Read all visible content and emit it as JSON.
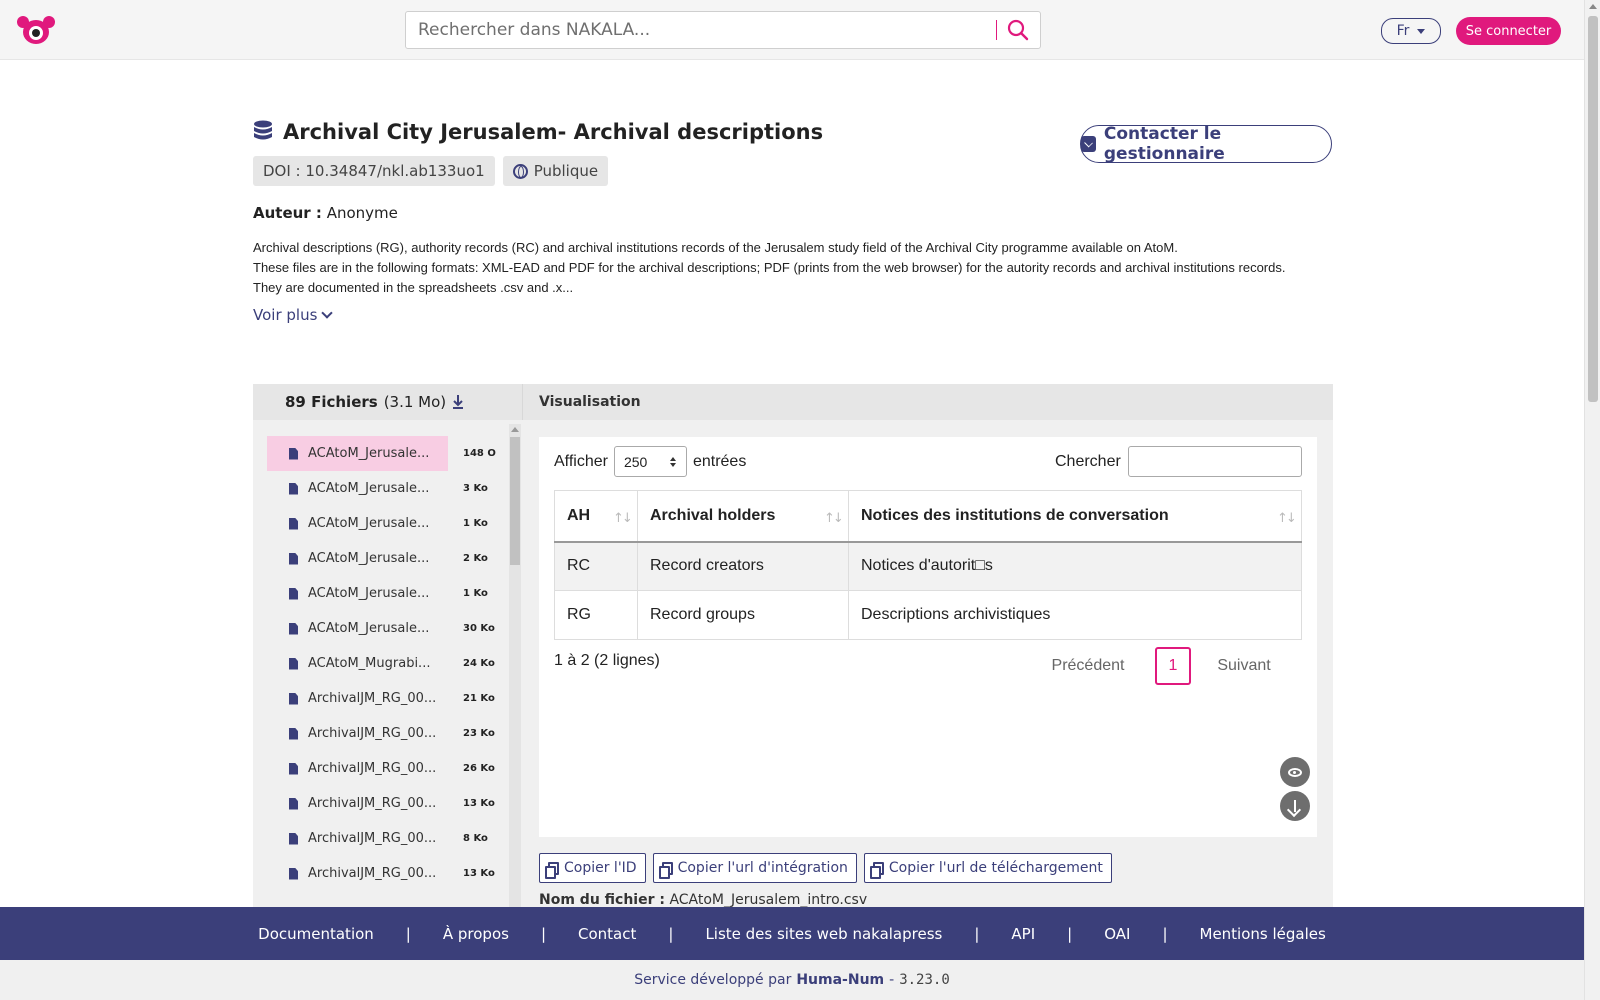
{
  "navbar": {
    "search_placeholder": "Rechercher dans NAKALA...",
    "lang": "Fr",
    "login": "Se connecter"
  },
  "header": {
    "title": "Archival City Jerusalem- Archival descriptions",
    "contact_button": "Contacter le gestionnaire",
    "doi": "DOI : 10.34847/nkl.ab133uo1",
    "visibility": "Publique",
    "author_label": "Auteur :",
    "author": "Anonyme",
    "description_lines": [
      "Archival descriptions (RG), authority records (RC) and archival institutions records of the Jerusalem study field of the Archival City programme available on AtoM.",
      "These files are in the following formats: XML-EAD and PDF for the archival descriptions; PDF (prints from the web browser) for the autority records and archival institutions records.",
      "They are documented in the spreadsheets .csv and .x..."
    ],
    "voir_plus": "Voir plus"
  },
  "files": {
    "count_label": "89 Fichiers",
    "size": "(3.1 Mo)",
    "items": [
      {
        "name": "ACAtoM_Jerusale...",
        "size": "148 O",
        "active": true
      },
      {
        "name": "ACAtoM_Jerusale...",
        "size": "3 Ko"
      },
      {
        "name": "ACAtoM_Jerusale...",
        "size": "1 Ko"
      },
      {
        "name": "ACAtoM_Jerusale...",
        "size": "2 Ko"
      },
      {
        "name": "ACAtoM_Jerusale...",
        "size": "1 Ko"
      },
      {
        "name": "ACAtoM_Jerusale...",
        "size": "30 Ko"
      },
      {
        "name": "ACAtoM_Mugrabi...",
        "size": "24 Ko"
      },
      {
        "name": "ArchivalJM_RG_00...",
        "size": "21 Ko"
      },
      {
        "name": "ArchivalJM_RG_00...",
        "size": "23 Ko"
      },
      {
        "name": "ArchivalJM_RG_00...",
        "size": "26 Ko"
      },
      {
        "name": "ArchivalJM_RG_00...",
        "size": "13 Ko"
      },
      {
        "name": "ArchivalJM_RG_00...",
        "size": "8 Ko"
      },
      {
        "name": "ArchivalJM_RG_00...",
        "size": "13 Ko"
      }
    ]
  },
  "visualisation": {
    "header": "Visualisation",
    "show_label": "Afficher",
    "show_value": "250",
    "entries_label": "entrées",
    "search_label": "Chercher",
    "columns": [
      "AH",
      "Archival holders",
      "Notices des institutions de conversation"
    ],
    "rows": [
      [
        "RC",
        "Record creators",
        "Notices d'autorit□s"
      ],
      [
        "RG",
        "Record groups",
        "Descriptions archivistiques"
      ]
    ],
    "info": "1 à 2 (2 lignes)",
    "prev": "Précédent",
    "page": "1",
    "next": "Suivant",
    "copy_id": "Copier l'ID",
    "copy_embed": "Copier l'url d'intégration",
    "copy_download": "Copier l'url de téléchargement",
    "file_name_label": "Nom du fichier :",
    "file_name": "ACAtoM_Jerusalem_intro.csv"
  },
  "footer": {
    "links": [
      "Documentation",
      "À propos",
      "Contact",
      "Liste des sites web nakalapress",
      "API",
      "OAI",
      "Mentions légales"
    ],
    "service_text": "Service développé par",
    "service_org": "Huma-Num",
    "dash": "-",
    "version": "3.23.0"
  },
  "colors": {
    "accent": "#e0197d",
    "primary": "#3b3f7a"
  }
}
